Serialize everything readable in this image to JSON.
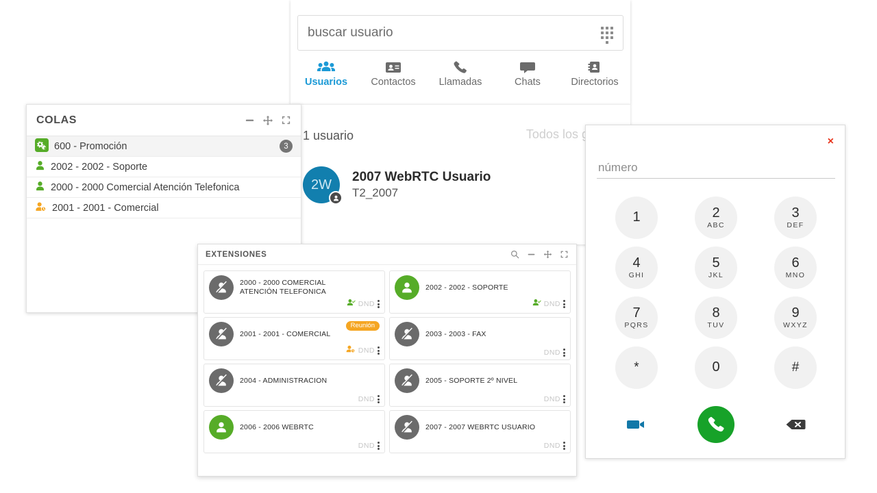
{
  "search": {
    "placeholder": "buscar usuario",
    "value": "",
    "dialpad_icon": "dialpad-grid-icon"
  },
  "tabs": [
    {
      "label": "Usuarios",
      "icon": "users-icon",
      "active": true
    },
    {
      "label": "Contactos",
      "icon": "contact-card-icon",
      "active": false
    },
    {
      "label": "Llamadas",
      "icon": "phone-icon",
      "active": false
    },
    {
      "label": "Chats",
      "icon": "chat-bubble-icon",
      "active": false
    },
    {
      "label": "Directorios",
      "icon": "address-book-icon",
      "active": false
    }
  ],
  "users_panel": {
    "count_label": "1 usuario",
    "group_filter_placeholder": "Todos los grupos",
    "user": {
      "avatar_initials": "2W",
      "avatar_color": "#127fae",
      "name": "2007 WebRTC Usuario",
      "subtitle": "T2_2007",
      "presence_badge_icon": "person-badge-icon"
    }
  },
  "colas_panel": {
    "title": "COLAS",
    "window_icons": [
      "minimize-icon",
      "move-icon",
      "maximize-icon"
    ],
    "items": [
      {
        "label": "600 - Promoción",
        "icon": "queue-gears-icon",
        "icon_color": "#56ac28",
        "count": "3",
        "selected": true
      },
      {
        "label": "2002 - 2002 - Soporte",
        "icon": "person-icon",
        "icon_color": "#56ac28",
        "count": "",
        "selected": false
      },
      {
        "label": "2000 - 2000 Comercial Atención Telefonica",
        "icon": "person-icon",
        "icon_color": "#56ac28",
        "count": "",
        "selected": false
      },
      {
        "label": "2001 - 2001 - Comercial",
        "icon": "person-clock-icon",
        "icon_color": "#f5a623",
        "count": "",
        "selected": false
      }
    ]
  },
  "extensiones_panel": {
    "title": "EXTENSIONES",
    "window_icons": [
      "search-icon",
      "minimize-icon",
      "move-icon",
      "maximize-icon"
    ],
    "dnd_label": "DND",
    "cards": [
      {
        "name": "2000 - 2000 COMERCIAL ATENCIÓN TELEFONICA",
        "status": "offline",
        "status_icon": "person-slash-icon",
        "footer_icon": "person-check-icon",
        "footer_icon_color": "#56ac28",
        "badge": "",
        "dnd": "DND"
      },
      {
        "name": "2002 - 2002 - SOPORTE",
        "status": "online",
        "status_icon": "person-icon",
        "footer_icon": "person-check-icon",
        "footer_icon_color": "#56ac28",
        "badge": "",
        "dnd": "DND"
      },
      {
        "name": "2001 - 2001 - COMERCIAL",
        "status": "offline",
        "status_icon": "person-slash-icon",
        "footer_icon": "person-clock-icon",
        "footer_icon_color": "#f5a623",
        "badge": "Reunión",
        "dnd": "DND"
      },
      {
        "name": "2003 - 2003 - FAX",
        "status": "offline",
        "status_icon": "person-slash-icon",
        "footer_icon": "",
        "footer_icon_color": "",
        "badge": "",
        "dnd": "DND"
      },
      {
        "name": "2004 - ADMINISTRACION",
        "status": "offline",
        "status_icon": "person-slash-icon",
        "footer_icon": "",
        "footer_icon_color": "",
        "badge": "",
        "dnd": "DND"
      },
      {
        "name": "2005 - SOPORTE 2º NIVEL",
        "status": "offline",
        "status_icon": "person-slash-icon",
        "footer_icon": "",
        "footer_icon_color": "",
        "badge": "",
        "dnd": "DND"
      },
      {
        "name": "2006 - 2006 WEBRTC",
        "status": "online",
        "status_icon": "person-icon",
        "footer_icon": "",
        "footer_icon_color": "",
        "badge": "",
        "dnd": "DND"
      },
      {
        "name": "2007 - 2007 WEBRTC USUARIO",
        "status": "offline",
        "status_icon": "person-slash-icon",
        "footer_icon": "",
        "footer_icon_color": "",
        "badge": "",
        "dnd": "DND"
      }
    ]
  },
  "dialpad": {
    "close_label": "×",
    "input_placeholder": "número",
    "input_value": "",
    "keys": [
      {
        "num": "1",
        "sub": ""
      },
      {
        "num": "2",
        "sub": "ABC"
      },
      {
        "num": "3",
        "sub": "DEF"
      },
      {
        "num": "4",
        "sub": "GHI"
      },
      {
        "num": "5",
        "sub": "JKL"
      },
      {
        "num": "6",
        "sub": "MNO"
      },
      {
        "num": "7",
        "sub": "PQRS"
      },
      {
        "num": "8",
        "sub": "TUV"
      },
      {
        "num": "9",
        "sub": "WXYZ"
      },
      {
        "num": "*",
        "sub": ""
      },
      {
        "num": "0",
        "sub": ""
      },
      {
        "num": "#",
        "sub": ""
      }
    ],
    "actions": [
      {
        "icon": "video-camera-icon",
        "color": "#1278a8"
      },
      {
        "icon": "phone-call-icon",
        "color": "#17a229"
      },
      {
        "icon": "backspace-icon",
        "color": "#3b3b3b"
      }
    ]
  },
  "colors": {
    "accent_blue": "#1c9ad6",
    "green": "#56ac28",
    "orange": "#f5a623",
    "red": "#e8341c",
    "gray": "#6b6b6b"
  }
}
